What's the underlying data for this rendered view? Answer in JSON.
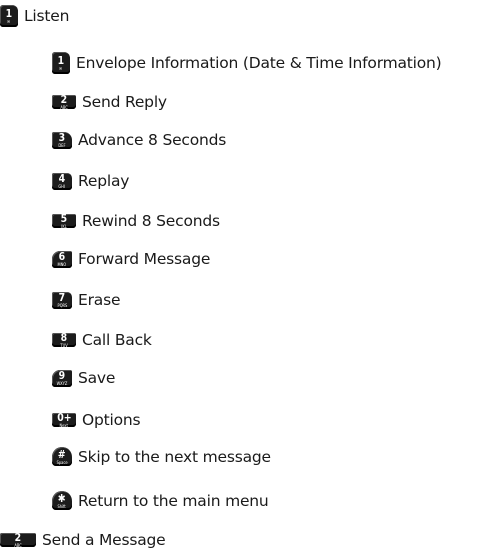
{
  "items": [
    {
      "label": "Listen",
      "key": "1",
      "sub": "✉"
    },
    {
      "label": "Envelope Information (Date & Time Information)",
      "key": "1",
      "sub": "✉"
    },
    {
      "label": "Send Reply",
      "key": "2",
      "sub": "ABC"
    },
    {
      "label": "Advance 8 Seconds",
      "key": "3",
      "sub": "DEF"
    },
    {
      "label": "Replay",
      "key": "4",
      "sub": "GHI"
    },
    {
      "label": "Rewind 8 Seconds",
      "key": "5",
      "sub": "JKL"
    },
    {
      "label": "Forward Message",
      "key": "6",
      "sub": "MNO"
    },
    {
      "label": "Erase",
      "key": "7",
      "sub": "PQRS"
    },
    {
      "label": "Call Back",
      "key": "8",
      "sub": "TUV"
    },
    {
      "label": "Save",
      "key": "9",
      "sub": "WXYZ"
    },
    {
      "label": "Options",
      "key": "0+",
      "sub": "Next"
    },
    {
      "label": "Skip to the next message",
      "key": "#",
      "sub": "Space"
    },
    {
      "label": "Return to the main menu",
      "key": "✱",
      "sub": "Shift"
    },
    {
      "label": "Send a Message",
      "key": "2",
      "sub": "ABC"
    }
  ]
}
